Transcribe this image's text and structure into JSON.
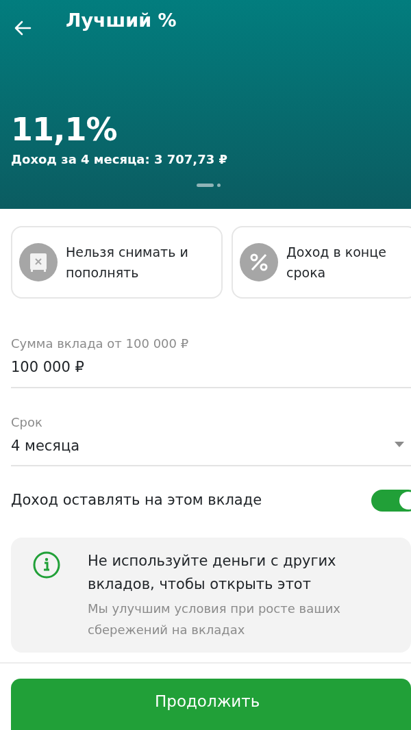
{
  "header": {
    "title": "Лучший %",
    "rate": "11,1%",
    "income": "Доход за 4 месяца: 3 707,73 ₽",
    "pager": [
      {
        "selected": true
      },
      {
        "selected": false
      }
    ]
  },
  "features": [
    {
      "kind": "safe",
      "text": "Нельзя снимать и пополнять"
    },
    {
      "kind": "percent",
      "text": "Доход в конце срока"
    }
  ],
  "fields": [
    {
      "kind": "input",
      "label": "Сумма вклада от 100 000 ₽",
      "value": "100 000 ₽"
    },
    {
      "kind": "select",
      "label": "Срок",
      "value": "4 месяца"
    }
  ],
  "toggle": {
    "label": "Доход оставлять на этом вкладе",
    "on": true
  },
  "notice": {
    "title": "Не используйте деньги с других вкладов, чтобы открыть этот",
    "text": "Мы улучшим условия при росте ваших сбережений на вкладах"
  },
  "button": "Продолжить"
}
